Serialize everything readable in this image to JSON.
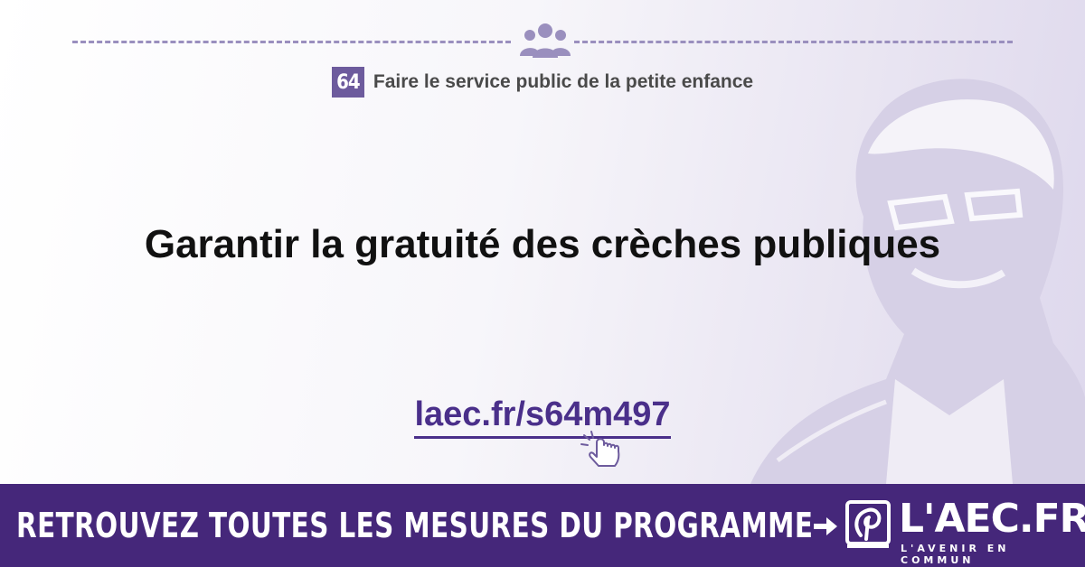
{
  "header": {
    "icon": "people-group-icon",
    "measure_number": "64",
    "subtitle": "Faire le service public de la petite enfance"
  },
  "main": {
    "headline": "Garantir la gratuité des crèches publiques",
    "link_text": "laec.fr/s64m497",
    "link_icon": "pointing-hand-click-icon"
  },
  "banner": {
    "text": "RETROUVEZ TOUTES LES MESURES DU PROGRAMME",
    "arrow_icon": "arrow-right-icon",
    "logo_name": "L'AEC.FR",
    "logo_tagline": "L'AVENIR EN COMMUN"
  },
  "colors": {
    "accent": "#6d5b9d",
    "link": "#4a2f8a",
    "banner": "#45277a",
    "dashes": "#9a8fbe"
  }
}
